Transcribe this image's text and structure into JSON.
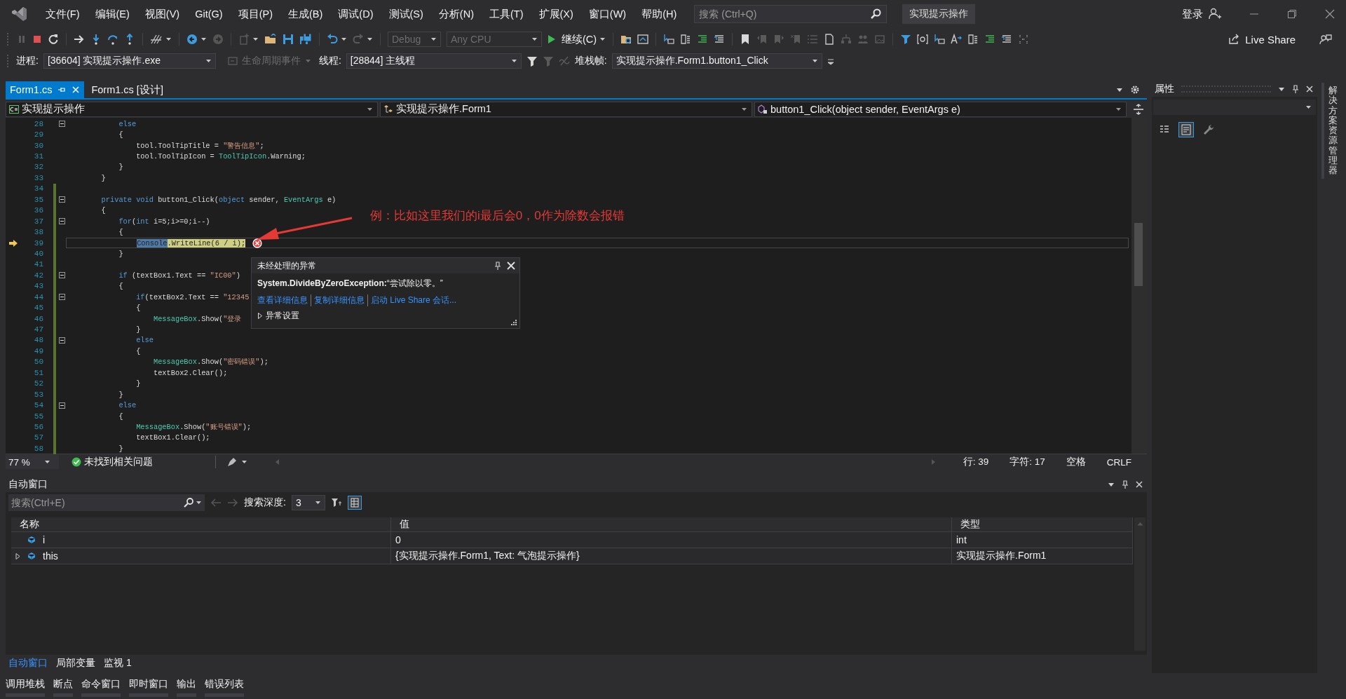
{
  "menu_bar": {
    "items": [
      "文件(F)",
      "编辑(E)",
      "视图(V)",
      "Git(G)",
      "项目(P)",
      "生成(B)",
      "调试(D)",
      "测试(S)",
      "分析(N)",
      "工具(T)",
      "扩展(X)",
      "窗口(W)",
      "帮助(H)"
    ]
  },
  "search": {
    "placeholder": "搜索 (Ctrl+Q)"
  },
  "solution_name": "实现提示操作",
  "account": {
    "label": "登录"
  },
  "toolbar": {
    "configuration": {
      "value": "Debug",
      "disabled": true
    },
    "platform": {
      "value": "Any CPU",
      "disabled": true
    },
    "continue_button": "继续(C)",
    "live_share_button": "Live Share"
  },
  "debug_location": {
    "process_label": "进程:",
    "process": "[36604] 实现提示操作.exe",
    "lifecycle_events": {
      "label": "生命周期事件",
      "disabled": true
    },
    "thread_label": "线程:",
    "thread": "[28844] 主线程",
    "stack_frame_label": "堆栈帧:",
    "stack_frame": "实现提示操作.Form1.button1_Click"
  },
  "document_tabs": [
    {
      "label": "Form1.cs",
      "selected": true
    },
    {
      "label": "Form1.cs [设计]",
      "selected": false
    }
  ],
  "navigation_bar": {
    "project": "实现提示操作",
    "type": "实现提示操作.Form1",
    "member": "button1_Click(object sender, EventArgs e)"
  },
  "code": {
    "lines": [
      {
        "number": "28",
        "changed": false,
        "fold": true,
        "current": false,
        "tokens": [
          {
            "text": "            else",
            "kind": "keyword"
          }
        ]
      },
      {
        "number": "29",
        "changed": false,
        "fold": false,
        "current": false,
        "tokens": [
          {
            "text": "            {",
            "kind": "plain"
          }
        ]
      },
      {
        "number": "30",
        "changed": false,
        "fold": false,
        "current": false,
        "tokens": [
          {
            "text": "                tool.ToolTipTitle = ",
            "kind": "plain"
          },
          {
            "text": "\"警告信息\"",
            "kind": "string"
          },
          {
            "text": ";",
            "kind": "plain"
          }
        ]
      },
      {
        "number": "31",
        "changed": false,
        "fold": false,
        "current": false,
        "tokens": [
          {
            "text": "                tool.ToolTipIcon = ",
            "kind": "plain"
          },
          {
            "text": "ToolTipIcon",
            "kind": "type"
          },
          {
            "text": ".Warning;",
            "kind": "plain"
          }
        ]
      },
      {
        "number": "32",
        "changed": false,
        "fold": false,
        "current": false,
        "tokens": [
          {
            "text": "            }",
            "kind": "plain"
          }
        ]
      },
      {
        "number": "33",
        "changed": false,
        "fold": false,
        "current": false,
        "tokens": [
          {
            "text": "        }",
            "kind": "plain"
          }
        ]
      },
      {
        "number": "34",
        "changed": true,
        "fold": false,
        "current": false
      },
      {
        "number": "35",
        "changed": true,
        "fold": true,
        "current": false,
        "tokens": [
          {
            "text": "        private void",
            "kind": "keyword"
          },
          {
            "text": " button1_Click(",
            "kind": "plain"
          },
          {
            "text": "object",
            "kind": "keyword"
          },
          {
            "text": " sender, ",
            "kind": "plain"
          },
          {
            "text": "EventArgs",
            "kind": "type"
          },
          {
            "text": " e)",
            "kind": "plain"
          }
        ]
      },
      {
        "number": "36",
        "changed": true,
        "fold": false,
        "current": false,
        "tokens": [
          {
            "text": "        {",
            "kind": "plain"
          }
        ]
      },
      {
        "number": "37",
        "changed": true,
        "fold": true,
        "current": false,
        "tokens": [
          {
            "text": "            for",
            "kind": "keyword"
          },
          {
            "text": "(",
            "kind": "plain"
          },
          {
            "text": "int",
            "kind": "keyword"
          },
          {
            "text": " i=5;i>=0;i--)",
            "kind": "plain"
          }
        ]
      },
      {
        "number": "38",
        "changed": true,
        "fold": false,
        "current": false,
        "tokens": [
          {
            "text": "            {",
            "kind": "plain"
          }
        ]
      },
      {
        "number": "39",
        "changed": true,
        "fold": false,
        "current": true,
        "tokens": [
          {
            "text": "                Console",
            "kind": "selected"
          },
          {
            "text": ".WriteLine(6 / i);",
            "kind": "statement"
          }
        ]
      },
      {
        "number": "40",
        "changed": true,
        "fold": false,
        "current": false,
        "tokens": [
          {
            "text": "            }",
            "kind": "plain"
          }
        ]
      },
      {
        "number": "41",
        "changed": true,
        "fold": false,
        "current": false
      },
      {
        "number": "42",
        "changed": true,
        "fold": true,
        "current": false,
        "tokens": [
          {
            "text": "            if",
            "kind": "keyword"
          },
          {
            "text": " (textBox1.Text == ",
            "kind": "plain"
          },
          {
            "text": "\"IC00\"",
            "kind": "string"
          },
          {
            "text": ")",
            "kind": "plain"
          }
        ]
      },
      {
        "number": "43",
        "changed": true,
        "fold": false,
        "current": false,
        "tokens": [
          {
            "text": "            {",
            "kind": "plain"
          }
        ]
      },
      {
        "number": "44",
        "changed": true,
        "fold": true,
        "current": false,
        "tokens": [
          {
            "text": "                if",
            "kind": "keyword"
          },
          {
            "text": "(textBox2.Text == ",
            "kind": "plain"
          },
          {
            "text": "\"12345",
            "kind": "string"
          }
        ]
      },
      {
        "number": "45",
        "changed": true,
        "fold": false,
        "current": false,
        "tokens": [
          {
            "text": "                {",
            "kind": "plain"
          }
        ]
      },
      {
        "number": "46",
        "changed": true,
        "fold": false,
        "current": false,
        "tokens": [
          {
            "text": "                    MessageBox",
            "kind": "type"
          },
          {
            "text": ".Show(",
            "kind": "plain"
          },
          {
            "text": "\"登录",
            "kind": "string"
          }
        ]
      },
      {
        "number": "47",
        "changed": true,
        "fold": false,
        "current": false,
        "tokens": [
          {
            "text": "                }",
            "kind": "plain"
          }
        ]
      },
      {
        "number": "48",
        "changed": true,
        "fold": true,
        "current": false,
        "tokens": [
          {
            "text": "                else",
            "kind": "keyword"
          }
        ]
      },
      {
        "number": "49",
        "changed": true,
        "fold": false,
        "current": false,
        "tokens": [
          {
            "text": "                {",
            "kind": "plain"
          }
        ]
      },
      {
        "number": "50",
        "changed": true,
        "fold": false,
        "current": false,
        "tokens": [
          {
            "text": "                    MessageBox",
            "kind": "type"
          },
          {
            "text": ".Show(",
            "kind": "plain"
          },
          {
            "text": "\"密码错误\"",
            "kind": "string"
          },
          {
            "text": ");",
            "kind": "plain"
          }
        ]
      },
      {
        "number": "51",
        "changed": true,
        "fold": false,
        "current": false,
        "tokens": [
          {
            "text": "                    textBox2.Clear();",
            "kind": "plain"
          }
        ]
      },
      {
        "number": "52",
        "changed": true,
        "fold": false,
        "current": false,
        "tokens": [
          {
            "text": "                }",
            "kind": "plain"
          }
        ]
      },
      {
        "number": "53",
        "changed": true,
        "fold": false,
        "current": false,
        "tokens": [
          {
            "text": "            }",
            "kind": "plain"
          }
        ]
      },
      {
        "number": "54",
        "changed": true,
        "fold": true,
        "current": false,
        "tokens": [
          {
            "text": "            else",
            "kind": "keyword"
          }
        ]
      },
      {
        "number": "55",
        "changed": true,
        "fold": false,
        "current": false,
        "tokens": [
          {
            "text": "            {",
            "kind": "plain"
          }
        ]
      },
      {
        "number": "56",
        "changed": true,
        "fold": false,
        "current": false,
        "tokens": [
          {
            "text": "                MessageBox",
            "kind": "type"
          },
          {
            "text": ".Show(",
            "kind": "plain"
          },
          {
            "text": "\"账号错误\"",
            "kind": "string"
          },
          {
            "text": ");",
            "kind": "plain"
          }
        ]
      },
      {
        "number": "57",
        "changed": true,
        "fold": false,
        "current": false,
        "tokens": [
          {
            "text": "                textBox1.Clear();",
            "kind": "plain"
          }
        ]
      },
      {
        "number": "58",
        "changed": true,
        "fold": false,
        "current": false,
        "tokens": [
          {
            "text": "            }",
            "kind": "plain"
          }
        ]
      }
    ]
  },
  "annotation": {
    "text": "例：比如这里我们的i最后会0，0作为除数会报错"
  },
  "exception_popup": {
    "title": "未经处理的异常",
    "message": "**System.DivideByZeroException:**“尝试除以零。”",
    "links": [
      "查看详细信息",
      "复制详细信息",
      "启动 Live Share 会话..."
    ],
    "settings": {
      "label": "异常设置",
      "expanded": false
    }
  },
  "editor_status": {
    "zoom": "77 %",
    "issues": "未找到相关问题",
    "line": "行: 39",
    "column": "字符: 17",
    "indent": "空格",
    "line_ending": "CRLF"
  },
  "autos_window": {
    "title": "自动窗口",
    "search_placeholder": "搜索(Ctrl+E)",
    "depth_label": "搜索深度:",
    "depth": "3",
    "columns": [
      "名称",
      "值",
      "类型"
    ],
    "rows": [
      {
        "name": "i",
        "value": "0",
        "type": "int",
        "expandable": false
      },
      {
        "name": "this",
        "value": "{实现提示操作.Form1, Text: 气泡提示操作}",
        "type": "实现提示操作.Form1",
        "expandable": true
      }
    ]
  },
  "tool_tabs": [
    {
      "label": "自动窗口",
      "selected": true
    },
    {
      "label": "局部变量",
      "selected": false
    },
    {
      "label": "监视 1",
      "selected": false
    }
  ],
  "bottom_tabs": [
    "调用堆栈",
    "断点",
    "命令窗口",
    "即时窗口",
    "输出",
    "错误列表"
  ],
  "properties_panel": {
    "title": "属性"
  },
  "side_tabs": [
    "解决方案资源管理器"
  ]
}
